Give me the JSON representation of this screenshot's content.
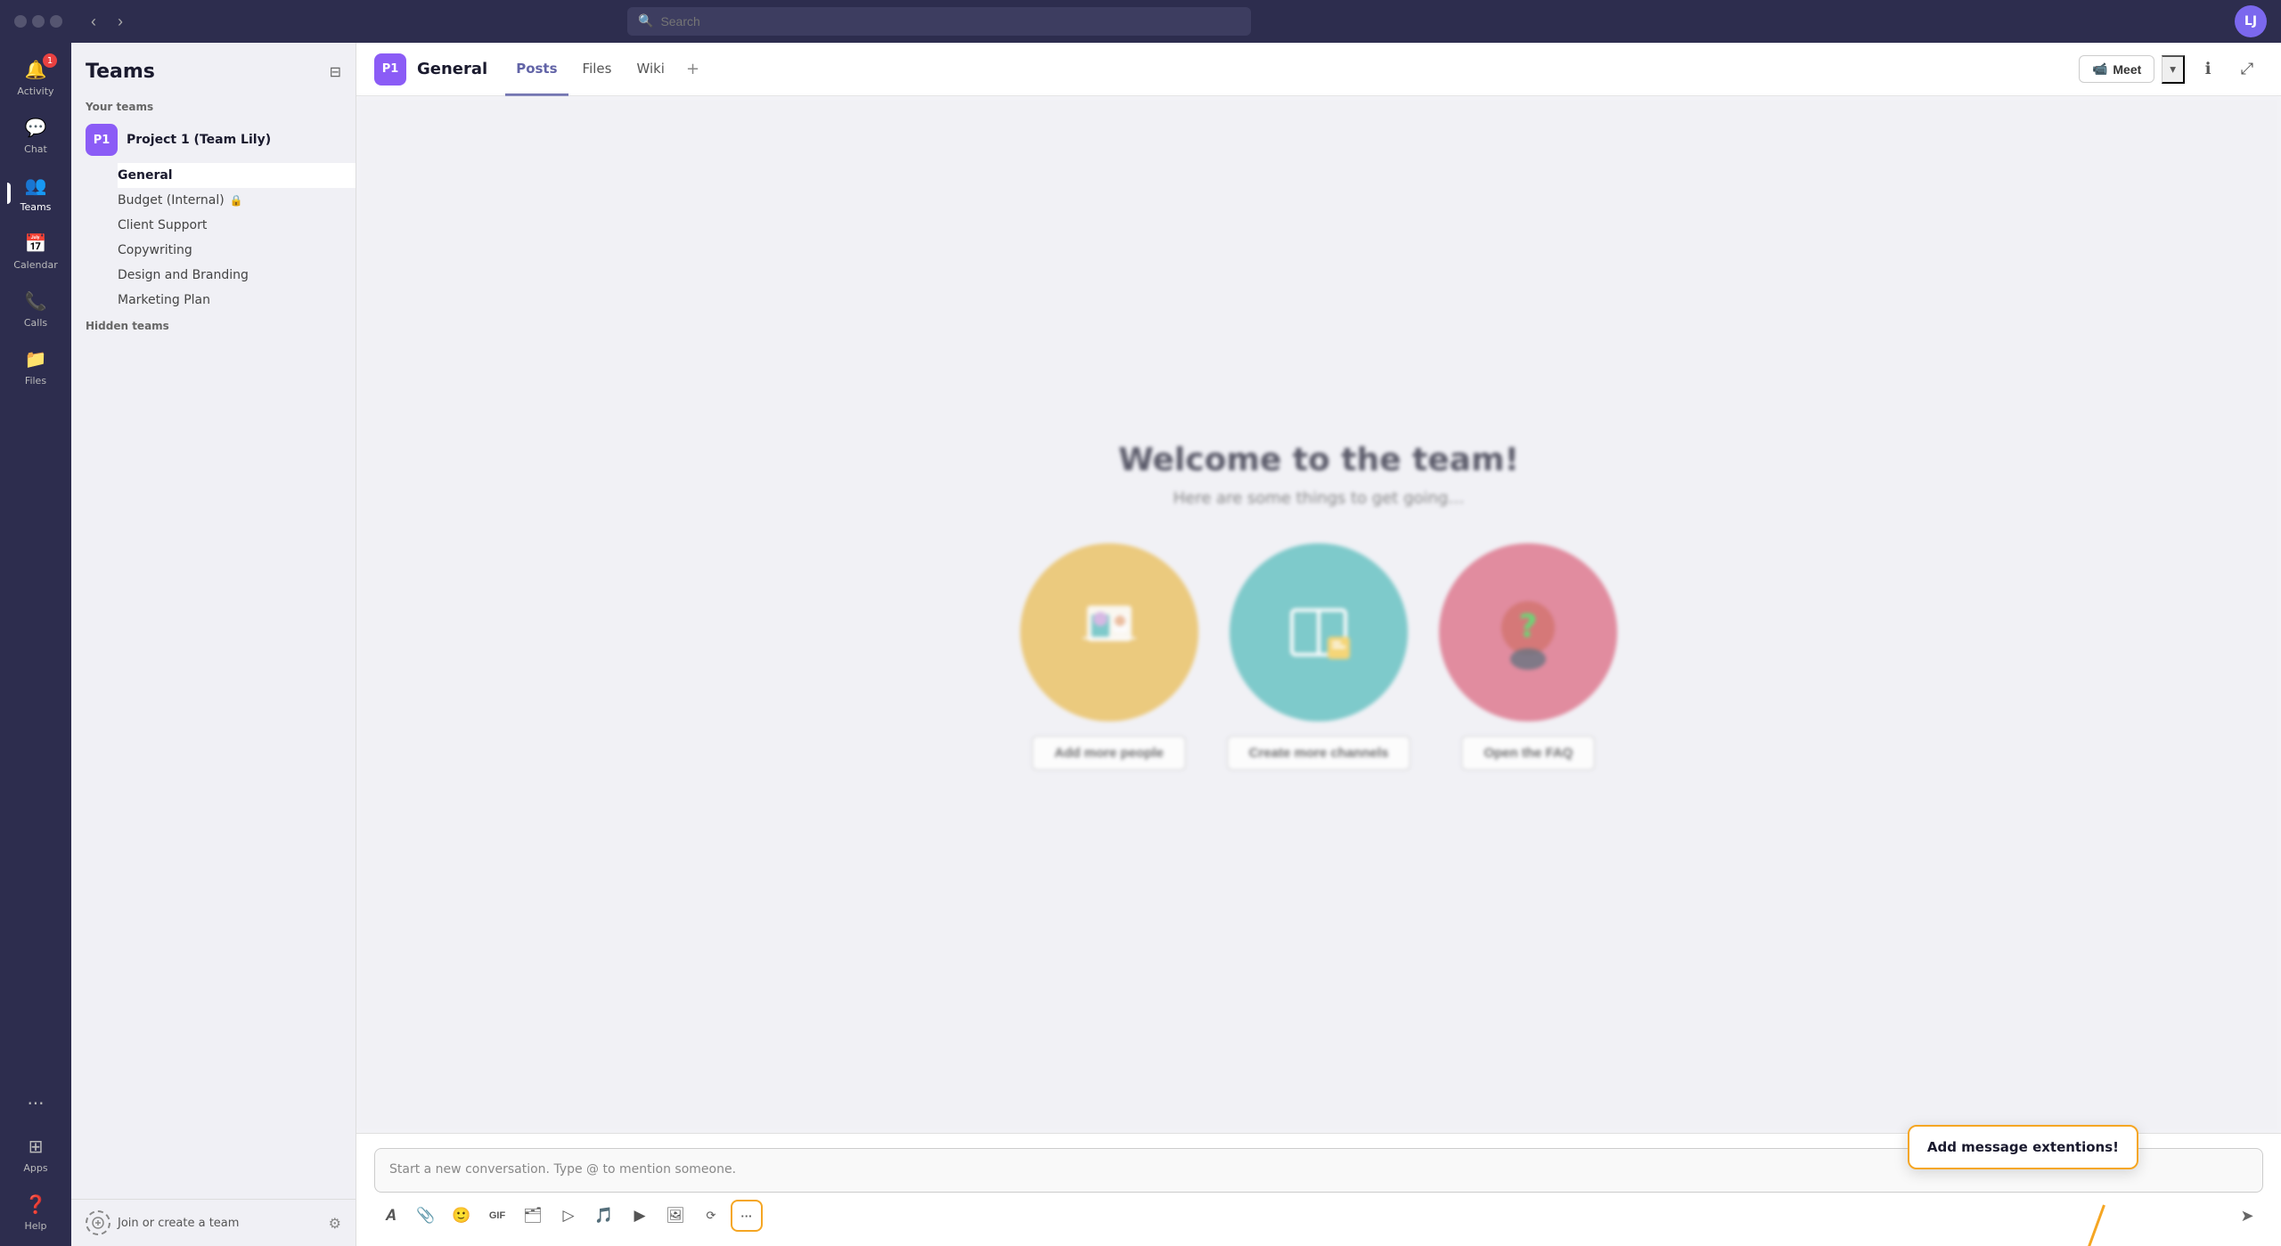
{
  "titlebar": {
    "search_placeholder": "Search"
  },
  "sidebar": {
    "items": [
      {
        "id": "activity",
        "label": "Activity",
        "icon": "🔔",
        "badge": "1"
      },
      {
        "id": "chat",
        "label": "Chat",
        "icon": "💬",
        "badge": null
      },
      {
        "id": "teams",
        "label": "Teams",
        "icon": "👥",
        "badge": null,
        "active": true
      },
      {
        "id": "calendar",
        "label": "Calendar",
        "icon": "📅",
        "badge": null
      },
      {
        "id": "calls",
        "label": "Calls",
        "icon": "📞",
        "badge": null
      },
      {
        "id": "files",
        "label": "Files",
        "icon": "📁",
        "badge": null
      }
    ],
    "more_label": "...",
    "apps_label": "Apps",
    "help_label": "Help"
  },
  "teams_panel": {
    "title": "Teams",
    "section_your_teams": "Your teams",
    "team_name": "Project 1 (Team Lily)",
    "team_initials": "P1",
    "channels": [
      {
        "name": "General",
        "active": true
      },
      {
        "name": "Budget (Internal)",
        "locked": true
      },
      {
        "name": "Client Support",
        "locked": false
      },
      {
        "name": "Copywriting",
        "locked": false
      },
      {
        "name": "Design and Branding",
        "locked": false
      },
      {
        "name": "Marketing Plan",
        "locked": false
      }
    ],
    "section_hidden": "Hidden teams",
    "join_create": "Join or create a team",
    "more_icon": "···"
  },
  "channel_header": {
    "icon_initials": "P1",
    "channel_name": "General",
    "tabs": [
      {
        "label": "Posts",
        "active": true
      },
      {
        "label": "Files",
        "active": false
      },
      {
        "label": "Wiki",
        "active": false
      }
    ],
    "add_tab_label": "+",
    "meet_label": "Meet",
    "meet_icon": "📹"
  },
  "welcome": {
    "title": "Welcome to the team!",
    "subtitle": "Here are some things to get going…",
    "cards": [
      {
        "action": "Add more people",
        "emoji": "👥"
      },
      {
        "action": "Create more channels",
        "emoji": "📋"
      },
      {
        "action": "Open the FAQ",
        "emoji": "❓"
      }
    ]
  },
  "compose": {
    "placeholder": "Start a new conversation. Type @ to mention someone.",
    "toolbar_items": [
      {
        "id": "format",
        "icon": "𝐴",
        "label": "Format"
      },
      {
        "id": "attach",
        "icon": "📎",
        "label": "Attach"
      },
      {
        "id": "emoji",
        "icon": "😊",
        "label": "Emoji"
      },
      {
        "id": "gif",
        "icon": "GIF",
        "label": "GIF"
      },
      {
        "id": "sticker",
        "icon": "🗂",
        "label": "Sticker"
      },
      {
        "id": "meet",
        "icon": "▷",
        "label": "Meet"
      },
      {
        "id": "audio",
        "icon": "🎵",
        "label": "Audio"
      },
      {
        "id": "video",
        "icon": "▶",
        "label": "Video"
      },
      {
        "id": "image",
        "icon": "🖼",
        "label": "Image"
      },
      {
        "id": "loop",
        "icon": "⟳",
        "label": "Loop"
      },
      {
        "id": "more",
        "icon": "···",
        "label": "More",
        "highlighted": true
      }
    ],
    "send_icon": "➤"
  },
  "tooltip": {
    "text": "Add message extentions!"
  }
}
